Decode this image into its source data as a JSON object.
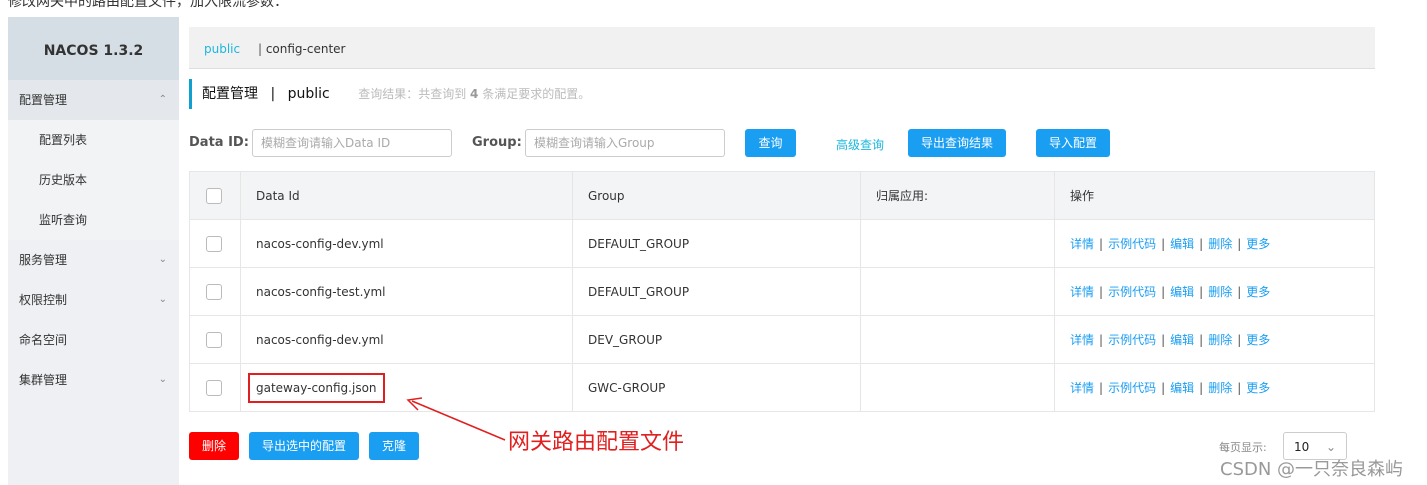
{
  "caption": "修改网关中的路由配置文件，加入限流参数：",
  "sidebar": {
    "logo": "NACOS 1.3.2",
    "items": [
      {
        "label": "配置管理",
        "type": "top",
        "chevron": "^"
      },
      {
        "label": "配置列表",
        "type": "sub"
      },
      {
        "label": "历史版本",
        "type": "sub"
      },
      {
        "label": "监听查询",
        "type": "sub"
      },
      {
        "label": "服务管理",
        "type": "menu",
        "chevron": "v"
      },
      {
        "label": "权限控制",
        "type": "menu",
        "chevron": "v"
      },
      {
        "label": "命名空间",
        "type": "menu"
      },
      {
        "label": "集群管理",
        "type": "menu",
        "chevron": "v"
      }
    ]
  },
  "header": {
    "namespace": "public",
    "separator": "|",
    "other": "config-center"
  },
  "title": {
    "main": "配置管理",
    "sep": "|",
    "ns": "public",
    "result_prefix": "查询结果：共查询到",
    "count": "4",
    "result_suffix": "条满足要求的配置。"
  },
  "search": {
    "dataid_label": "Data ID:",
    "dataid_placeholder": "模糊查询请输入Data ID",
    "group_label": "Group:",
    "group_placeholder": "模糊查询请输入Group",
    "query": "查询",
    "advanced": "高级查询",
    "export": "导出查询结果",
    "import": "导入配置"
  },
  "table": {
    "headers": [
      "Data Id",
      "Group",
      "归属应用:",
      "操作"
    ],
    "rows": [
      {
        "dataid": "nacos-config-dev.yml",
        "group": "DEFAULT_GROUP",
        "app": ""
      },
      {
        "dataid": "nacos-config-test.yml",
        "group": "DEFAULT_GROUP",
        "app": ""
      },
      {
        "dataid": "nacos-config-dev.yml",
        "group": "DEV_GROUP",
        "app": ""
      },
      {
        "dataid": "gateway-config.json",
        "group": "GWC-GROUP",
        "app": ""
      }
    ],
    "ops": [
      "详情",
      "示例代码",
      "编辑",
      "删除",
      "更多"
    ]
  },
  "footer": {
    "delete": "删除",
    "export_selected": "导出选中的配置",
    "clone": "克隆",
    "page_size_label": "每页显示:",
    "page_size": "10"
  },
  "annotation": "网关路由配置文件",
  "watermark": "CSDN @一只奈良森屿",
  "colors": {
    "accent": "#1a9ef2",
    "link": "#1bb7dc",
    "danger": "#ff0000",
    "annotation": "#e02020"
  }
}
